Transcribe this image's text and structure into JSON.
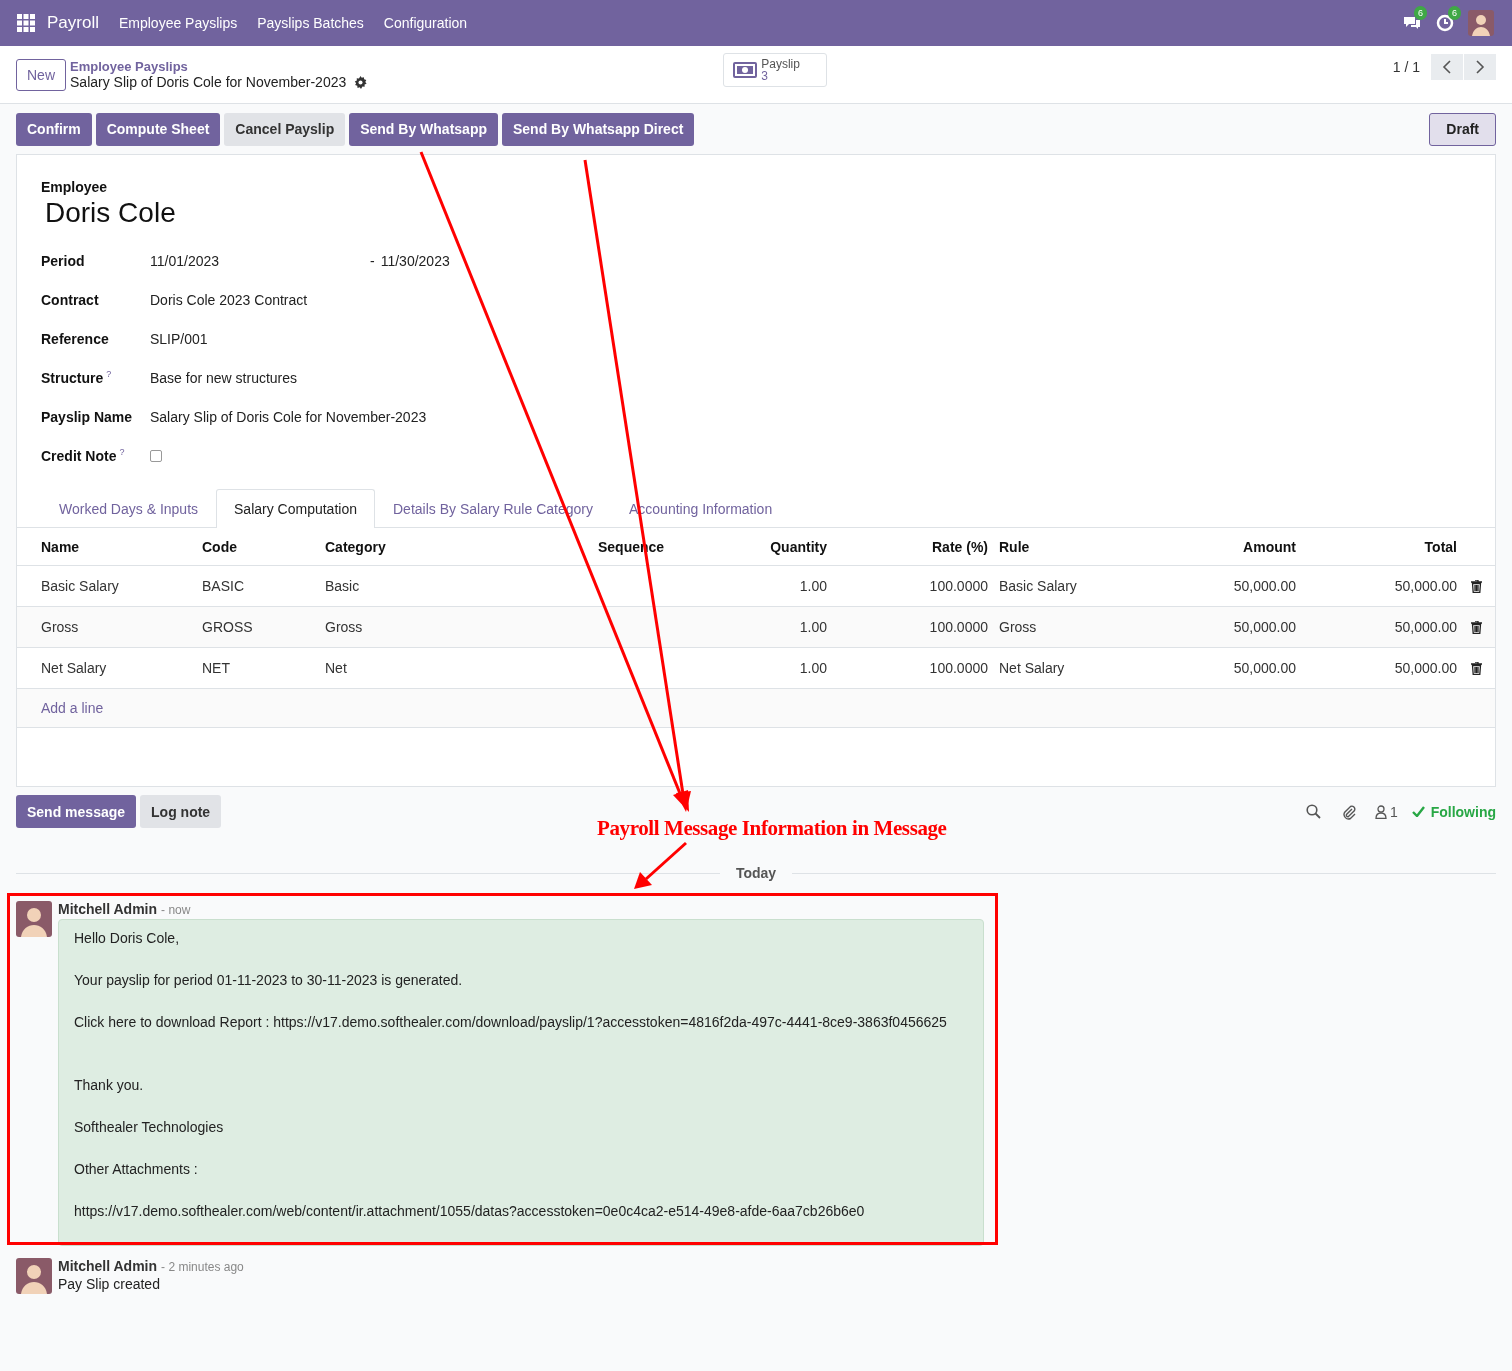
{
  "navbar": {
    "app": "Payroll",
    "menus": [
      "Employee Payslips",
      "Payslips Batches",
      "Configuration"
    ],
    "messages_count": "6",
    "activities_count": "6"
  },
  "control_panel": {
    "new_button": "New",
    "breadcrumb": "Employee Payslips",
    "record_title": "Salary Slip of Doris Cole for November-2023",
    "smart_button": {
      "label": "Payslip",
      "count": "3"
    },
    "pager": "1 / 1"
  },
  "actions": [
    {
      "label": "Confirm",
      "kind": "primary"
    },
    {
      "label": "Compute Sheet",
      "kind": "primary"
    },
    {
      "label": "Cancel Payslip",
      "kind": "secondary"
    },
    {
      "label": "Send By Whatsapp",
      "kind": "primary"
    },
    {
      "label": "Send By Whatsapp Direct",
      "kind": "primary"
    }
  ],
  "status": "Draft",
  "form": {
    "employee_label": "Employee",
    "employee": "Doris Cole",
    "fields": [
      {
        "label": "Period",
        "kind": "range",
        "value": "11/01/2023",
        "separator": "-",
        "value_end": "11/30/2023"
      },
      {
        "label": "Contract",
        "kind": "text",
        "value": "Doris Cole 2023 Contract"
      },
      {
        "label": "Reference",
        "kind": "text",
        "value": "SLIP/001"
      },
      {
        "label": "Structure",
        "kind": "text",
        "help": "?",
        "value": "Base for new structures"
      },
      {
        "label": "Payslip Name",
        "kind": "text",
        "value": "Salary Slip of Doris Cole for November-2023"
      },
      {
        "label": "Credit Note",
        "kind": "checkbox",
        "help": "?",
        "checked": false
      }
    ]
  },
  "tabs": [
    {
      "label": "Worked Days & Inputs",
      "selected": false
    },
    {
      "label": "Salary Computation",
      "selected": true
    },
    {
      "label": "Details By Salary Rule Category",
      "selected": false
    },
    {
      "label": "Accounting Information",
      "selected": false
    }
  ],
  "table": {
    "columns": [
      "Name",
      "Code",
      "Category",
      "Sequence",
      "Quantity",
      "Rate (%)",
      "Rule",
      "Amount",
      "Total"
    ],
    "rows": [
      {
        "cells": [
          "Basic Salary",
          "BASIC",
          "Basic",
          "",
          "1.00",
          "100.0000",
          "Basic Salary",
          "50,000.00",
          "50,000.00"
        ]
      },
      {
        "cells": [
          "Gross",
          "GROSS",
          "Gross",
          "",
          "1.00",
          "100.0000",
          "Gross",
          "50,000.00",
          "50,000.00"
        ]
      },
      {
        "cells": [
          "Net Salary",
          "NET",
          "Net",
          "",
          "1.00",
          "100.0000",
          "Net Salary",
          "50,000.00",
          "50,000.00"
        ]
      }
    ],
    "add_line": "Add a line"
  },
  "chatter": {
    "buttons": [
      {
        "label": "Send message",
        "kind": "primary"
      },
      {
        "label": "Log note",
        "kind": "secondary"
      }
    ],
    "followers_count": "1",
    "following": "Following",
    "date_separator": "Today",
    "messages": [
      {
        "author": "Mitchell Admin",
        "time": "- now",
        "kind": "bubble",
        "paragraphs": [
          "Hello Doris Cole,",
          "Your payslip for period 01-11-2023 to 30-11-2023 is generated.",
          "Click here to download Report : https://v17.demo.softhealer.com/download/payslip/1?accesstoken=4816f2da-497c-4441-8ce9-3863f0456625",
          "Thank you.",
          "Softhealer Technologies",
          "Other Attachments :",
          "https://v17.demo.softhealer.com/web/content/ir.attachment/1055/datas?accesstoken=0e0c4ca2-e514-49e8-afde-6aa7cb26b6e0"
        ]
      },
      {
        "author": "Mitchell Admin",
        "time": "- 2 minutes ago",
        "kind": "plain",
        "paragraphs": [
          "Pay Slip created"
        ]
      }
    ]
  },
  "annotation": {
    "caption": "Payroll Message Information in Message"
  }
}
